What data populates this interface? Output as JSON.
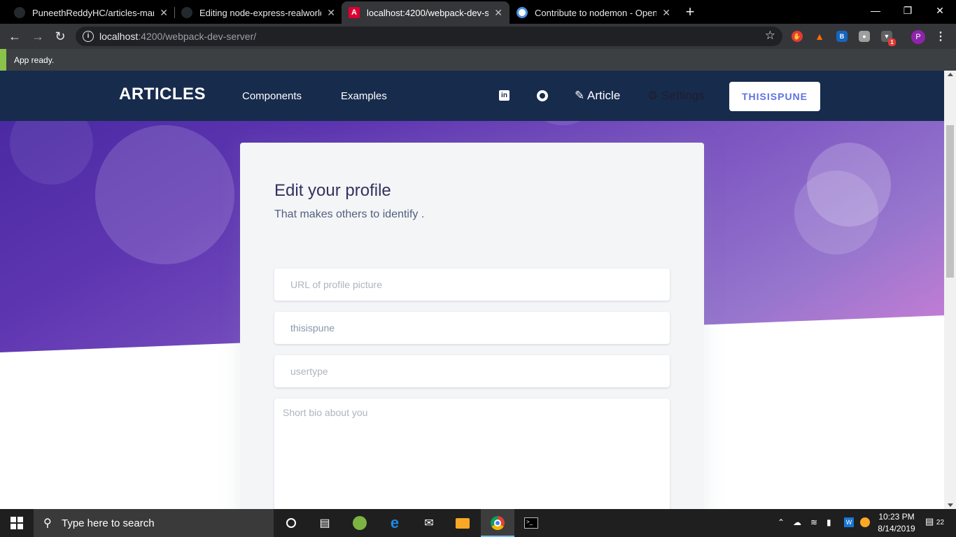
{
  "browser": {
    "tabs": [
      {
        "title": "PuneethReddyHC/articles-manag",
        "icon": "github-icon"
      },
      {
        "title": "Editing node-express-realworld-e",
        "icon": "github-icon"
      },
      {
        "title": "localhost:4200/webpack-dev-serv",
        "icon": "angular-icon",
        "favicon_letter": "A"
      },
      {
        "title": "Contribute to nodemon - Open C",
        "icon": "opencollective-icon"
      }
    ],
    "url_host": "localhost",
    "url_rest": ":4200/webpack-dev-server/",
    "profile_initial": "P",
    "extension_badge": "1"
  },
  "infobar": {
    "message": "App ready."
  },
  "navbar": {
    "brand": "ARTICLES",
    "links": [
      "Components",
      "Examples"
    ],
    "article_label": "Article",
    "settings_label": "Settings",
    "user_button": "THISISPUNE"
  },
  "profile_form": {
    "title": "Edit your profile",
    "subtitle": "That makes others to identify .",
    "picture_placeholder": "URL of profile picture",
    "username_value": "thisispune",
    "usertype_placeholder": "usertype",
    "bio_placeholder": "Short bio about you"
  },
  "taskbar": {
    "search_placeholder": "Type here to search",
    "time": "10:23 PM",
    "date": "8/14/2019",
    "notification_count": "22"
  },
  "colors": {
    "navbar_bg": "#172b4d",
    "accent": "#5e72e4",
    "hero_start": "#4527a0",
    "hero_end": "#ce7fd6"
  }
}
